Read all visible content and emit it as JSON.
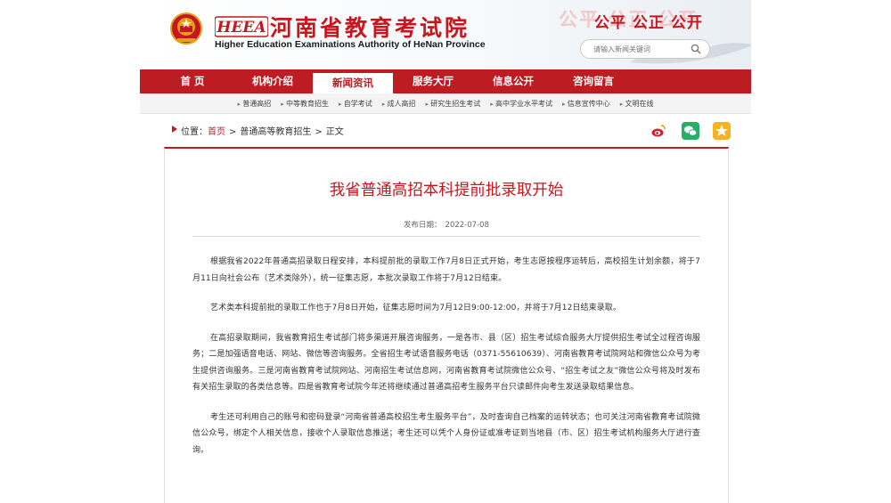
{
  "header": {
    "title_cn": "河南省教育考试院",
    "title_en": "Higher Education Examinations Authority of HeNan Province",
    "logo_text": "HEEA",
    "slogan": "公平 公正 公开",
    "slogan_shadow": "公平 公正 公开",
    "search_placeholder": "请输入新闻关键词"
  },
  "nav": {
    "items": [
      {
        "label": "首 页"
      },
      {
        "label": "机构介绍"
      },
      {
        "label": "新闻资讯"
      },
      {
        "label": "服务大厅"
      },
      {
        "label": "信息公开"
      },
      {
        "label": "咨询留言"
      }
    ],
    "active_index": 2
  },
  "subnav": {
    "items": [
      "普通高招",
      "中等教育招生",
      "自学考试",
      "成人高招",
      "研究生招生考试",
      "高中学业水平考试",
      "信息宣传中心",
      "文明在线"
    ]
  },
  "breadcrumb": {
    "prefix": "位置：",
    "home": "首页",
    "sep": ">",
    "section": "普通高等教育招生",
    "current": "正文"
  },
  "article": {
    "title": "我省普通高招本科提前批录取开始",
    "date_label": "发布日期：",
    "date": "2022-07-08",
    "paragraphs": [
      "根据我省2022年普通高招录取日程安排，本科提前批的录取工作7月8日正式开始，考生志愿按程序运转后，高校招生计划余额，将于7月11日向社会公布（艺术类除外），统一征集志愿，本批次录取工作将于7月12日结束。",
      "艺术类本科提前批的录取工作也于7月8日开始，征集志愿时间为7月12日9:00-12:00，并将于7月12日结束录取。",
      "在高招录取期间，我省教育招生考试部门将多渠道开展咨询服务，一是各市、县（区）招生考试综合服务大厅提供招生考试全过程咨询服务；二是加强语音电话、网站、微信等咨询服务。全省招生考试语音服务电话（0371-55610639）、河南省教育考试院网站和微信公众号为考生提供咨询服务。三是河南省教育考试院网站、河南招生考试信息网，河南省教育考试院微信公众号、“招生考试之友”微信公众号将及时发布有关招生录取的各类信息等。四是省教育考试院今年还将继续通过普通高招考生服务平台只读邮件向考生发送录取结果信息。",
      "考生还可利用自己的账号和密码登录“河南省普通高校招生考生服务平台”，及时查询自己档案的运转状态；也可关注河南省教育考试院微信公众号，绑定个人相关信息，接收个人录取信息推送；考生还可以凭个人身份证或准考证到当地县（市、区）招生考试机构服务大厅进行查询。"
    ]
  },
  "share": {
    "icons": [
      "weibo-icon",
      "wechat-icon",
      "qzone-icon"
    ]
  },
  "colors": {
    "brand_red": "#bc1c22",
    "title_red": "#c8161e",
    "wechat_green": "#2aae67",
    "qzone_yellow": "#f5b324"
  }
}
